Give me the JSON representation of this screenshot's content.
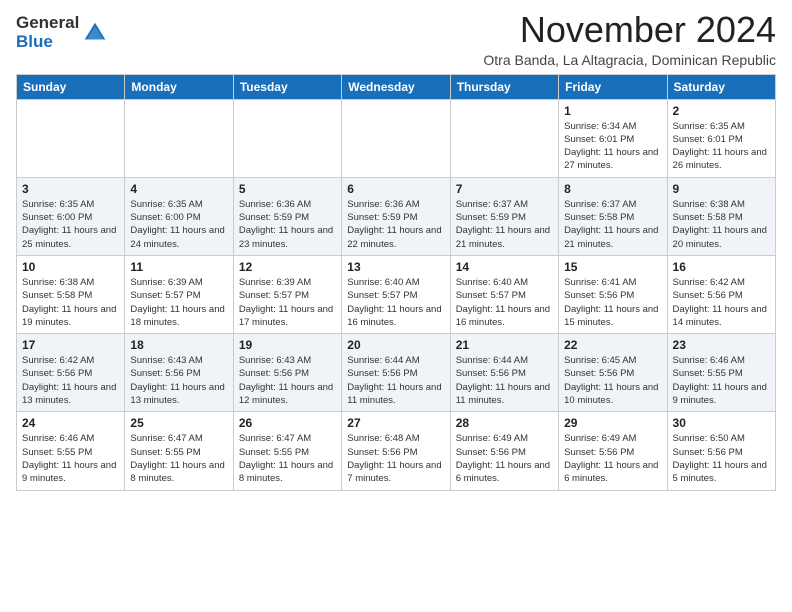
{
  "logo": {
    "general": "General",
    "blue": "Blue"
  },
  "title": "November 2024",
  "subtitle": "Otra Banda, La Altagracia, Dominican Republic",
  "days_of_week": [
    "Sunday",
    "Monday",
    "Tuesday",
    "Wednesday",
    "Thursday",
    "Friday",
    "Saturday"
  ],
  "weeks": [
    [
      null,
      null,
      null,
      null,
      null,
      {
        "day": 1,
        "sunrise": "6:34 AM",
        "sunset": "6:01 PM",
        "daylight": "11 hours and 27 minutes."
      },
      {
        "day": 2,
        "sunrise": "6:35 AM",
        "sunset": "6:01 PM",
        "daylight": "11 hours and 26 minutes."
      }
    ],
    [
      {
        "day": 3,
        "sunrise": "6:35 AM",
        "sunset": "6:00 PM",
        "daylight": "11 hours and 25 minutes."
      },
      {
        "day": 4,
        "sunrise": "6:35 AM",
        "sunset": "6:00 PM",
        "daylight": "11 hours and 24 minutes."
      },
      {
        "day": 5,
        "sunrise": "6:36 AM",
        "sunset": "5:59 PM",
        "daylight": "11 hours and 23 minutes."
      },
      {
        "day": 6,
        "sunrise": "6:36 AM",
        "sunset": "5:59 PM",
        "daylight": "11 hours and 22 minutes."
      },
      {
        "day": 7,
        "sunrise": "6:37 AM",
        "sunset": "5:59 PM",
        "daylight": "11 hours and 21 minutes."
      },
      {
        "day": 8,
        "sunrise": "6:37 AM",
        "sunset": "5:58 PM",
        "daylight": "11 hours and 21 minutes."
      },
      {
        "day": 9,
        "sunrise": "6:38 AM",
        "sunset": "5:58 PM",
        "daylight": "11 hours and 20 minutes."
      }
    ],
    [
      {
        "day": 10,
        "sunrise": "6:38 AM",
        "sunset": "5:58 PM",
        "daylight": "11 hours and 19 minutes."
      },
      {
        "day": 11,
        "sunrise": "6:39 AM",
        "sunset": "5:57 PM",
        "daylight": "11 hours and 18 minutes."
      },
      {
        "day": 12,
        "sunrise": "6:39 AM",
        "sunset": "5:57 PM",
        "daylight": "11 hours and 17 minutes."
      },
      {
        "day": 13,
        "sunrise": "6:40 AM",
        "sunset": "5:57 PM",
        "daylight": "11 hours and 16 minutes."
      },
      {
        "day": 14,
        "sunrise": "6:40 AM",
        "sunset": "5:57 PM",
        "daylight": "11 hours and 16 minutes."
      },
      {
        "day": 15,
        "sunrise": "6:41 AM",
        "sunset": "5:56 PM",
        "daylight": "11 hours and 15 minutes."
      },
      {
        "day": 16,
        "sunrise": "6:42 AM",
        "sunset": "5:56 PM",
        "daylight": "11 hours and 14 minutes."
      }
    ],
    [
      {
        "day": 17,
        "sunrise": "6:42 AM",
        "sunset": "5:56 PM",
        "daylight": "11 hours and 13 minutes."
      },
      {
        "day": 18,
        "sunrise": "6:43 AM",
        "sunset": "5:56 PM",
        "daylight": "11 hours and 13 minutes."
      },
      {
        "day": 19,
        "sunrise": "6:43 AM",
        "sunset": "5:56 PM",
        "daylight": "11 hours and 12 minutes."
      },
      {
        "day": 20,
        "sunrise": "6:44 AM",
        "sunset": "5:56 PM",
        "daylight": "11 hours and 11 minutes."
      },
      {
        "day": 21,
        "sunrise": "6:44 AM",
        "sunset": "5:56 PM",
        "daylight": "11 hours and 11 minutes."
      },
      {
        "day": 22,
        "sunrise": "6:45 AM",
        "sunset": "5:56 PM",
        "daylight": "11 hours and 10 minutes."
      },
      {
        "day": 23,
        "sunrise": "6:46 AM",
        "sunset": "5:55 PM",
        "daylight": "11 hours and 9 minutes."
      }
    ],
    [
      {
        "day": 24,
        "sunrise": "6:46 AM",
        "sunset": "5:55 PM",
        "daylight": "11 hours and 9 minutes."
      },
      {
        "day": 25,
        "sunrise": "6:47 AM",
        "sunset": "5:55 PM",
        "daylight": "11 hours and 8 minutes."
      },
      {
        "day": 26,
        "sunrise": "6:47 AM",
        "sunset": "5:55 PM",
        "daylight": "11 hours and 8 minutes."
      },
      {
        "day": 27,
        "sunrise": "6:48 AM",
        "sunset": "5:56 PM",
        "daylight": "11 hours and 7 minutes."
      },
      {
        "day": 28,
        "sunrise": "6:49 AM",
        "sunset": "5:56 PM",
        "daylight": "11 hours and 6 minutes."
      },
      {
        "day": 29,
        "sunrise": "6:49 AM",
        "sunset": "5:56 PM",
        "daylight": "11 hours and 6 minutes."
      },
      {
        "day": 30,
        "sunrise": "6:50 AM",
        "sunset": "5:56 PM",
        "daylight": "11 hours and 5 minutes."
      }
    ]
  ]
}
